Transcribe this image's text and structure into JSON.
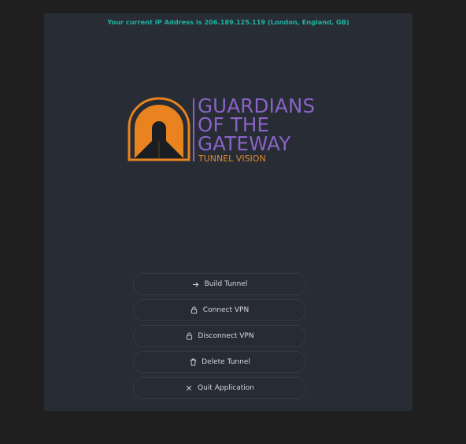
{
  "status": {
    "ip_text": "Your current IP Address is 206.189.125.119 (London, England, GB)"
  },
  "logo": {
    "line1": "GUARDIANS",
    "line2": "OF THE",
    "line3": "GATEWAY",
    "subtitle": "TUNNEL VISION",
    "colors": {
      "tunnel": "#e8831f",
      "title": "#8a63c8",
      "subtitle": "#e08a2c"
    }
  },
  "buttons": [
    {
      "label": "Build Tunnel",
      "icon": "arrow-right-icon"
    },
    {
      "label": "Connect VPN",
      "icon": "lock-icon"
    },
    {
      "label": "Disconnect VPN",
      "icon": "unlock-icon"
    },
    {
      "label": "Delete Tunnel",
      "icon": "trash-icon"
    },
    {
      "label": "Quit Application",
      "icon": "close-icon"
    }
  ],
  "colors": {
    "background": "#282c34",
    "status_text": "#20b2a4",
    "button_text": "#d7d9de"
  }
}
